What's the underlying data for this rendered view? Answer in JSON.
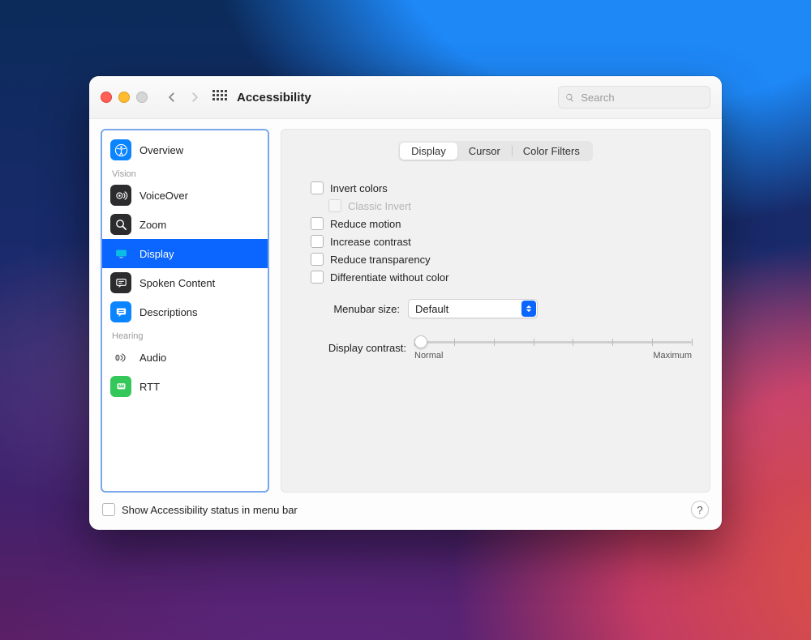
{
  "window": {
    "title": "Accessibility"
  },
  "search": {
    "placeholder": "Search"
  },
  "sidebar": {
    "sections": [
      {
        "label": null,
        "items": [
          {
            "label": "Overview"
          }
        ]
      },
      {
        "label": "Vision",
        "items": [
          {
            "label": "VoiceOver"
          },
          {
            "label": "Zoom"
          },
          {
            "label": "Display",
            "selected": true
          },
          {
            "label": "Spoken Content"
          },
          {
            "label": "Descriptions"
          }
        ]
      },
      {
        "label": "Hearing",
        "items": [
          {
            "label": "Audio"
          },
          {
            "label": "RTT"
          }
        ]
      }
    ]
  },
  "tabs": {
    "items": [
      "Display",
      "Cursor",
      "Color Filters"
    ],
    "active": 0
  },
  "checks": {
    "invert": "Invert colors",
    "classic_invert": "Classic Invert",
    "reduce_motion": "Reduce motion",
    "increase_contrast": "Increase contrast",
    "reduce_transparency": "Reduce transparency",
    "differentiate": "Differentiate without color"
  },
  "menubar": {
    "label": "Menubar size:",
    "value": "Default"
  },
  "contrast": {
    "label": "Display contrast:",
    "min_label": "Normal",
    "max_label": "Maximum"
  },
  "footer": {
    "show_status": "Show Accessibility status in menu bar"
  }
}
